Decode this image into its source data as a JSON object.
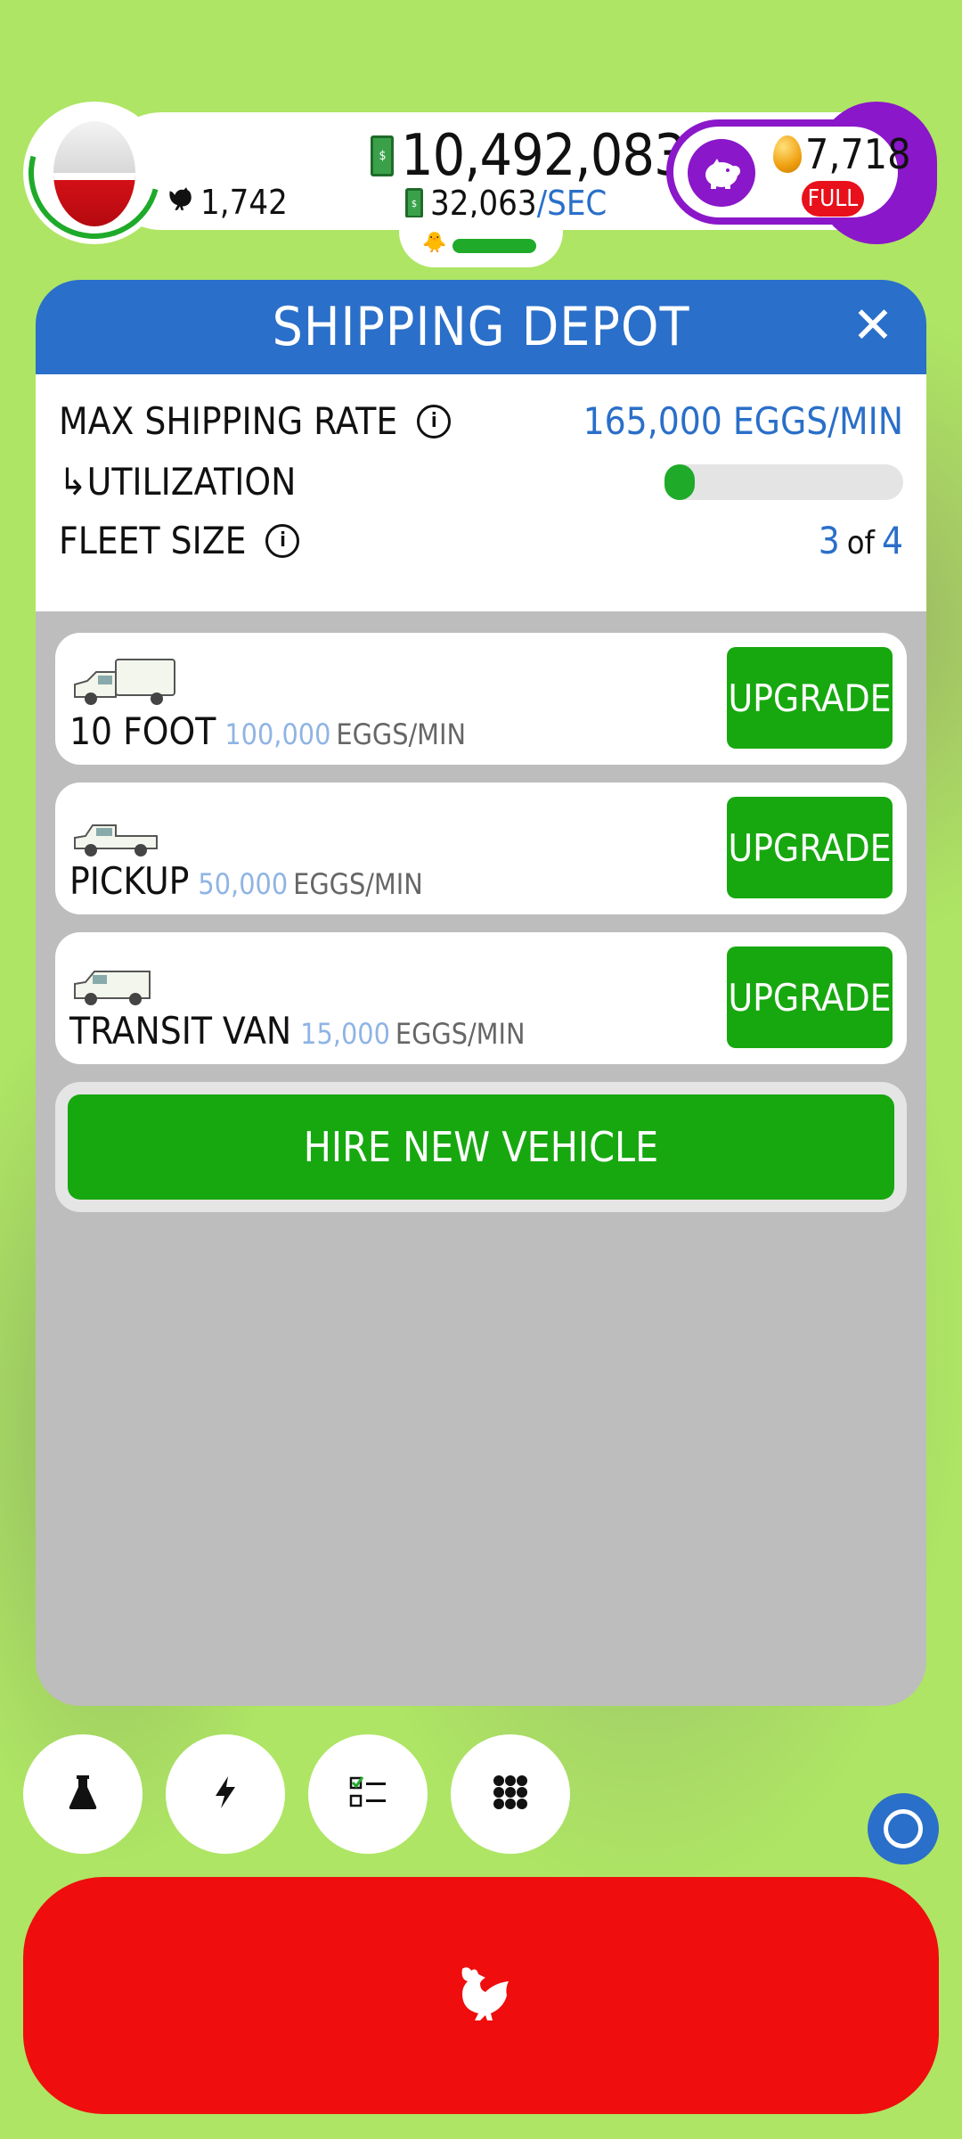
{
  "hud": {
    "chicken_count": "1,742",
    "money": "10,492,083",
    "earn_rate": "32,063",
    "earn_rate_unit": "/SEC",
    "golden_eggs": "7,718",
    "silo_status": "FULL"
  },
  "dialog": {
    "title": "SHIPPING DEPOT",
    "max_rate_label": "MAX SHIPPING RATE",
    "max_rate_value": "165,000 EGGS/MIN",
    "utilization_label": "↳UTILIZATION",
    "utilization_fraction": 0.05,
    "fleet_label": "FLEET SIZE",
    "fleet_current": "3",
    "fleet_of": "of",
    "fleet_max": "4",
    "vehicles": [
      {
        "name": "10 FOOT",
        "rate": "100,000",
        "unit": "EGGS/MIN",
        "button": "UPGRADE"
      },
      {
        "name": "PICKUP",
        "rate": "50,000",
        "unit": "EGGS/MIN",
        "button": "UPGRADE"
      },
      {
        "name": "TRANSIT VAN",
        "rate": "15,000",
        "unit": "EGGS/MIN",
        "button": "UPGRADE"
      }
    ],
    "hire_button": "HIRE NEW VEHICLE"
  },
  "colors": {
    "header_blue": "#2a6fc9",
    "button_green": "#17a80f",
    "hatch_red": "#ef0d0d",
    "premium_purple": "#8a17c9",
    "background_green": "#aee564"
  },
  "icons": {
    "bottom_bar": [
      "flask-icon",
      "lightning-icon",
      "checklist-icon",
      "grid-menu-icon"
    ],
    "hatch": "chicken-icon"
  }
}
